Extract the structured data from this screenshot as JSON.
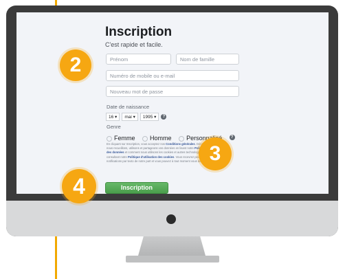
{
  "form": {
    "title": "Inscription",
    "subtitle": "C'est rapide et facile.",
    "firstname_placeholder": "Prénom",
    "lastname_placeholder": "Nom de famille",
    "contact_placeholder": "Numéro de mobile ou e-mail",
    "password_placeholder": "Nouveau mot de passe",
    "birthdate_label": "Date de naissance",
    "birth_day": "16",
    "birth_month": "mai",
    "birth_year": "1995",
    "gender_label": "Genre",
    "gender_options": [
      "Femme",
      "Homme",
      "Personnalisé"
    ],
    "legal_prefix": "En cliquant sur Inscription, vous acceptez nos ",
    "legal_link_conditions": "Conditions générales",
    "legal_mid1": ". Découvrez comment nous recueillons, utilisons et partageons vos données en lisant notre ",
    "legal_link_privacy": "Politique d'utilisation des données",
    "legal_mid2": " et comment nous utilisons les cookies et autres technologies similaires en consultant notre ",
    "legal_link_cookies": "Politique d'utilisation des cookies",
    "legal_suffix": ". Vous recevrez peut-être des notifications par texto de notre part et vous pouvez à tout moment vous désabonner.",
    "submit_label": "Inscription"
  },
  "badges": [
    "2",
    "3",
    "4"
  ],
  "colors": {
    "accent": "#f6a712",
    "button": "#4a9e4c",
    "bezel": "#3b3b3b",
    "link": "#385898"
  },
  "icons": [
    "help-icon",
    "chevron-down-icon",
    "webcam-dot"
  ]
}
